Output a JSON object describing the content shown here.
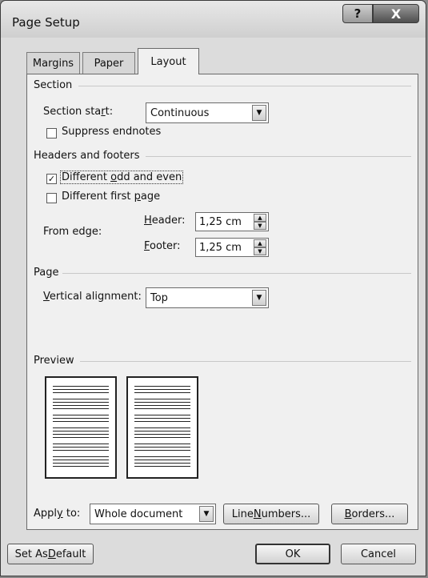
{
  "window": {
    "title": "Page Setup",
    "help_btn": "?",
    "close_btn": "X"
  },
  "tabs": [
    {
      "label": "Margins",
      "active": false
    },
    {
      "label": "Paper",
      "active": false
    },
    {
      "label": "Layout",
      "active": true
    }
  ],
  "section": {
    "heading": "Section",
    "start_label_pre": "Section sta",
    "start_label_u": "r",
    "start_label_post": "t:",
    "start_value": "Continuous",
    "suppress_label": "Suppress endnotes",
    "suppress_checked": false
  },
  "headers_footers": {
    "heading": "Headers and footers",
    "odd_even_pre": "Different ",
    "odd_even_u": "o",
    "odd_even_post": "dd and even",
    "odd_even_checked": true,
    "first_page_pre": "Different first ",
    "first_page_u": "p",
    "first_page_post": "age",
    "first_page_checked": false,
    "from_edge_label": "From edge:",
    "header_label_u": "H",
    "header_label_post": "eader:",
    "header_value": "1,25 cm",
    "footer_label_u": "F",
    "footer_label_post": "ooter:",
    "footer_value": "1,25 cm"
  },
  "page": {
    "heading": "Page",
    "valign_label_u": "V",
    "valign_label_post": "ertical alignment:",
    "valign_value": "Top"
  },
  "preview": {
    "heading": "Preview"
  },
  "apply": {
    "label_pre": "Appl",
    "label_u": "y",
    "label_post": " to:",
    "value": "Whole document"
  },
  "buttons": {
    "line_numbers_pre": "Line ",
    "line_numbers_u": "N",
    "line_numbers_post": "umbers...",
    "borders_u": "B",
    "borders_post": "orders...",
    "set_default_pre": "Set As ",
    "set_default_u": "D",
    "set_default_post": "efault",
    "ok": "OK",
    "cancel": "Cancel"
  }
}
